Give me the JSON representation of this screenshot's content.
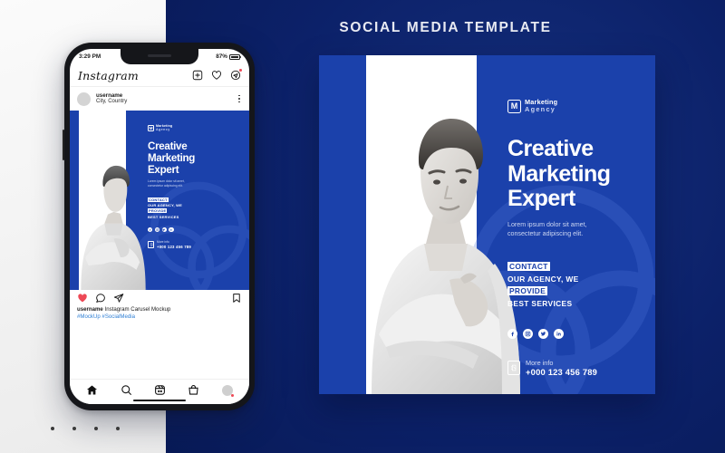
{
  "header": {
    "title": "SOCIAL MEDIA TEMPLATE"
  },
  "colors": {
    "background_navy": "#0c2169",
    "background_light": "#f7f7f7",
    "poster_blue": "#1b41ab",
    "accent_white": "#ffffff",
    "link_blue": "#2f7fd4",
    "heart_red": "#ed4956"
  },
  "phone": {
    "status": {
      "time": "3:29 PM",
      "battery": "87%"
    },
    "instagram": {
      "wordmark": "Instagram",
      "header_icons": [
        "add-post-icon",
        "heart-icon",
        "messenger-icon"
      ],
      "post": {
        "username": "username",
        "location": "City, Country",
        "menu_icon": "more-options-icon",
        "action_icons": [
          "like-icon",
          "comment-icon",
          "share-icon"
        ],
        "save_icon": "bookmark-icon",
        "caption_user": "username",
        "caption_text": "Instagram Carusel Mockup",
        "hashtags": "#MockUp #SocialMedia"
      },
      "nav_icons": [
        "home-icon",
        "search-icon",
        "reels-icon",
        "shop-icon",
        "profile-avatar"
      ]
    }
  },
  "carousel": {
    "dots": 4
  },
  "poster": {
    "logo": {
      "mark": "M",
      "line1": "Marketing",
      "line2": "Agency"
    },
    "headline": [
      "Creative",
      "Marketing",
      "Expert"
    ],
    "subtext": [
      "Lorem ipsum dolor sit amet,",
      "consectetur adipiscing elit."
    ],
    "contact": [
      {
        "text": "CONTACT",
        "highlight": true
      },
      {
        "text": "OUR AGENCY, WE",
        "highlight": false
      },
      {
        "text": "PROVIDE",
        "highlight": true
      },
      {
        "text": "BEST SERVICES",
        "highlight": false
      }
    ],
    "socials": [
      "facebook-icon",
      "instagram-icon",
      "twitter-icon",
      "linkedin-icon"
    ],
    "info": {
      "label": "More info",
      "phone": "+000 123 456 789",
      "icon": "contact-book-icon"
    }
  }
}
